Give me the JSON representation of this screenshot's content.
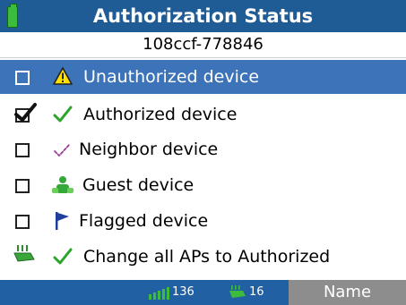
{
  "header": {
    "title": "Authorization Status",
    "battery_icon": "battery-icon",
    "accent": "#1f5c96"
  },
  "subtitle": "108ccf-778846",
  "items": [
    {
      "label": "Unauthorized device",
      "checked": false,
      "icon": "warning-icon",
      "selected": true
    },
    {
      "label": "Authorized device",
      "checked": true,
      "icon": "checkmark-icon",
      "selected": false
    },
    {
      "label": "Neighbor device",
      "checked": false,
      "icon": "neighbor-check-icon",
      "selected": false
    },
    {
      "label": "Guest device",
      "checked": false,
      "icon": "guest-icon",
      "selected": false
    },
    {
      "label": "Flagged device",
      "checked": false,
      "icon": "flag-icon",
      "selected": false
    }
  ],
  "action": {
    "label": "Change all APs to Authorized",
    "icons": [
      "access-point-icon",
      "checkmark-icon"
    ]
  },
  "status": {
    "signal_count": "136",
    "ap_count": "16",
    "softkey_label": "Name",
    "colors": {
      "bar": "#2160a3",
      "softkey": "#8d8d8d",
      "selection": "#3d73b9"
    }
  }
}
